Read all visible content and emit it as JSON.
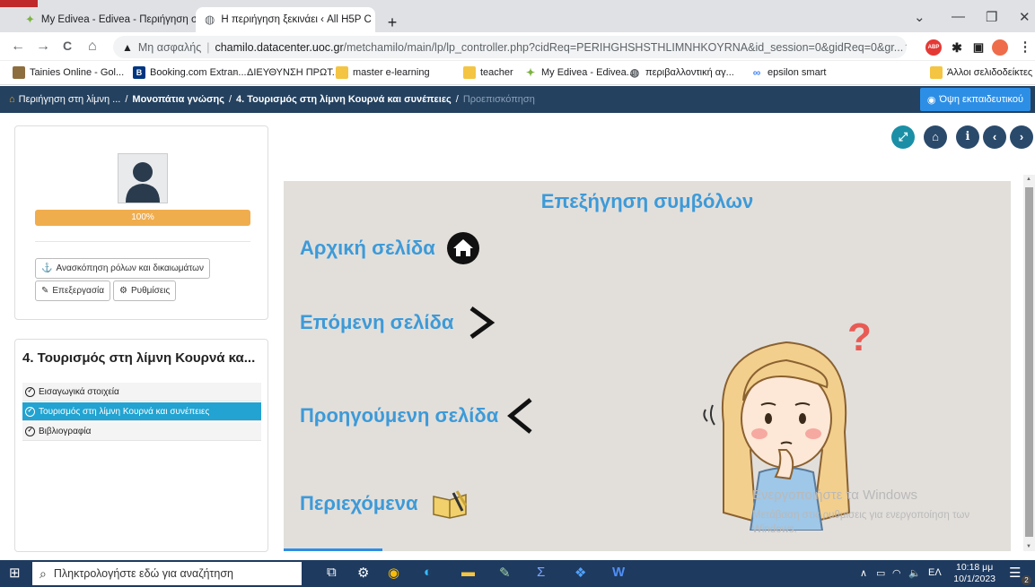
{
  "browser": {
    "tabs": [
      {
        "title": "My Edivea - Edivea - Περιήγηση σ",
        "close": "✕"
      },
      {
        "title": "Η περιήγηση ξεκινάει ‹ All H5P C",
        "close": "✕"
      }
    ],
    "new_tab": "+",
    "win": {
      "min": "—",
      "max": "❐",
      "close": "✕",
      "menu": "⌄"
    },
    "nav": {
      "back": "←",
      "forward": "→",
      "reload": "C",
      "home": "⌂"
    },
    "url": {
      "warning": "▲",
      "insecure": "Μη ασφαλής",
      "host": "chamilo.datacenter.uoc.gr",
      "path": "/metchamilo/main/lp/lp_controller.php?cidReq=PERIHGHSHSTHLIMNHKOYRNA&id_session=0&gidReq=0&gr..."
    },
    "ext": {
      "abp": "ABP",
      "menu": "⋮"
    },
    "bookmarks": [
      "Tainies Online - Gol...",
      "Booking.com Extran...",
      "ΔΙΕΥΘΥΝΣΗ ΠΡΩΤ...",
      "master e-learning",
      "teacher",
      "My Edivea - Edivea...",
      "περιβαλλοντική αγ...",
      "epsilon smart",
      "Άλλοι σελιδοδείκτες"
    ]
  },
  "breadcrumb": {
    "items": [
      "Περιήγηση στη λίμνη ...",
      "Μονοπάτια γνώσης",
      "4. Τουρισμός στη λίμνη Κουρνά και συνέπειες"
    ],
    "current": "Προεπισκόπηση",
    "sep": "/",
    "teacher_view": "Όψη εκπαιδευτικού"
  },
  "sidebar": {
    "progress": "100%",
    "progress_value": 1.0,
    "roles_button": "Ανασκόπηση ρόλων και δικαιωμάτων",
    "edit_button": "Επεξεργασία",
    "settings_button": "Ρυθμίσεις",
    "lp_title": "4. Τουρισμός στη λίμνη Κουρνά κα...",
    "items": [
      {
        "label": "Εισαγωγικά στοιχεία",
        "active": false
      },
      {
        "label": "Τουρισμός στη λίμνη Κουρνά και συνέπειες",
        "active": true
      },
      {
        "label": "Βιβλιογραφία",
        "active": false
      }
    ]
  },
  "slide": {
    "title": "Επεξήγηση συμβόλων",
    "rows": [
      {
        "label": "Αρχική σελίδα",
        "icon": "home-icon"
      },
      {
        "label": "Επόμενη σελίδα",
        "icon": "chevron-right-icon"
      },
      {
        "label": "Προηγούμενη σελίδα",
        "icon": "chevron-left-icon"
      },
      {
        "label": "Περιεχόμενα",
        "icon": "book-icon"
      }
    ],
    "question_mark": "?"
  },
  "watermark": {
    "title": "Ενεργοποιήστε τα Windows",
    "text": "Μετάβαση στις ρυθμίσεις για ενεργοποίηση των Windows."
  },
  "taskbar": {
    "search_placeholder": "Πληκτρολογήστε εδώ για αναζήτηση",
    "lang": "ΕΛ",
    "time": "10:18 μμ",
    "date": "10/1/2023",
    "notif_count": "2"
  }
}
